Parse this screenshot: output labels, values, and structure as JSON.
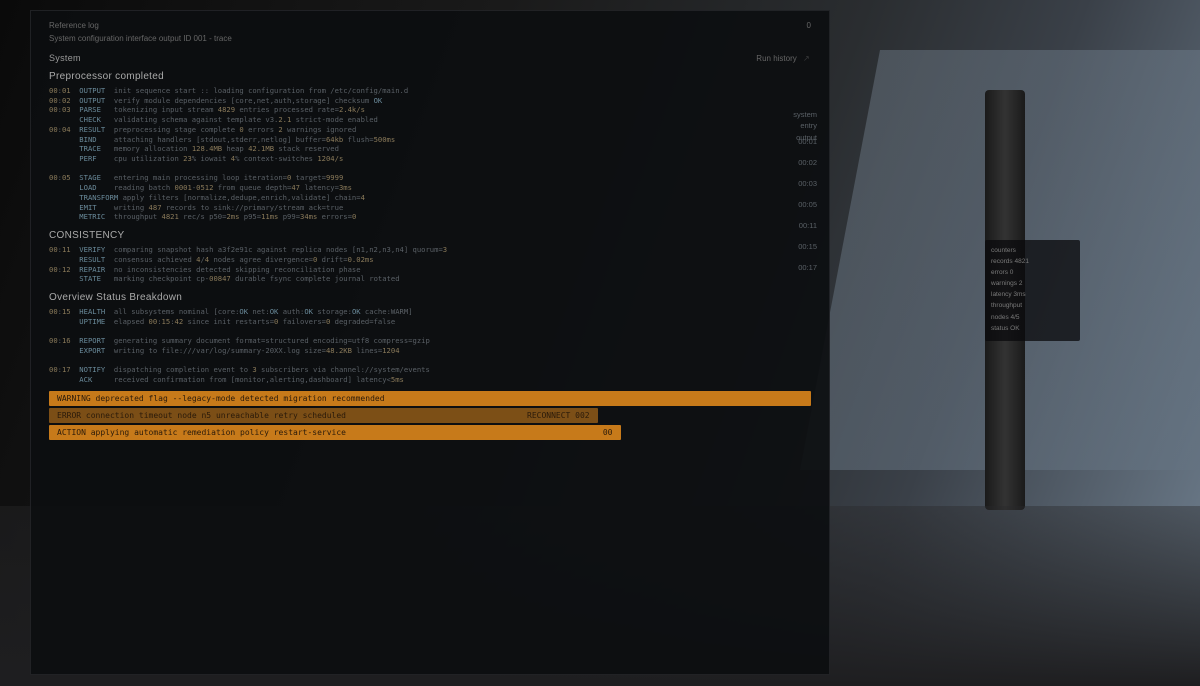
{
  "header": {
    "line1_left": "Reference log",
    "line1_right": "0",
    "line2": "System configuration interface output ID 001 - trace",
    "title": "System",
    "right_label": "Run history",
    "right_icon": "↗"
  },
  "section1": {
    "title": "Preprocessor completed",
    "side_values": [
      "system",
      "entry",
      "output"
    ],
    "lines": [
      "00:01  OUTPUT  init sequence start :: loading configuration from /etc/config/main.d",
      "00:02  OUTPUT  verify module dependencies [core,net,auth,storage] checksum OK",
      "00:03  PARSE   tokenizing input stream 4829 entries processed rate=2.4k/s",
      "       CHECK   validating schema against template v3.2.1 strict-mode enabled",
      "00:04  RESULT  preprocessing stage complete 0 errors 2 warnings ignored",
      "       BIND    attaching handlers [stdout,stderr,netlog] buffer=64kb flush=500ms",
      "       TRACE   memory allocation 128.4MB heap 42.1MB stack reserved",
      "       PERF    cpu utilization 23% iowait 4% context-switches 1204/s",
      "",
      "00:05  STAGE   entering main processing loop iteration=0 target=9999",
      "       LOAD    reading batch 0001-0512 from queue depth=47 latency=3ms",
      "       TRANSFORM apply filters [normalize,dedupe,enrich,validate] chain=4",
      "       EMIT    writing 487 records to sink://primary/stream ack=true",
      "       METRIC  throughput 4821 rec/s p50=2ms p95=11ms p99=34ms errors=0"
    ]
  },
  "section2": {
    "title": "CONSISTENCY",
    "lines": [
      "00:11  VERIFY  comparing snapshot hash a3f2e91c against replica nodes [n1,n2,n3,n4] quorum=3",
      "       RESULT  consensus achieved 4/4 nodes agree divergence=0 drift=0.02ms",
      "00:12  REPAIR  no inconsistencies detected skipping reconciliation phase",
      "       STATE   marking checkpoint cp-00847 durable fsync complete journal rotated"
    ]
  },
  "section3": {
    "title": "Overview Status Breakdown",
    "lines": [
      "00:15  HEALTH  all subsystems nominal [core:OK net:OK auth:OK storage:OK cache:WARM]",
      "       UPTIME  elapsed 00:15:42 since init restarts=0 failovers=0 degraded=false",
      "",
      "00:16  REPORT  generating summary document format=structured encoding=utf8 compress=gzip",
      "       EXPORT  writing to file:///var/log/summary-20XX.log size=48.2KB lines=1204",
      "",
      "00:17  NOTIFY  dispatching completion event to 3 subscribers via channel://system/events",
      "       ACK     received confirmation from [monitor,alerting,dashboard] latency<5ms"
    ]
  },
  "highlights": [
    {
      "text": "WARNING  deprecated flag --legacy-mode detected migration recommended",
      "tag": ""
    },
    {
      "text": "ERROR    connection timeout node n5 unreachable retry scheduled",
      "tag": "RECONNECT 002"
    },
    {
      "text": "ACTION   applying automatic remediation policy restart-service",
      "tag": "00"
    }
  ],
  "side_panel": {
    "lines": [
      "counters",
      "records 4821",
      "errors 0",
      "warnings 2",
      "latency 3ms",
      "throughput",
      "nodes 4/5",
      "status OK"
    ]
  },
  "right_col_values": [
    "00:01",
    "00:02",
    "00:03",
    "00:05",
    "00:11",
    "00:15",
    "00:17"
  ]
}
